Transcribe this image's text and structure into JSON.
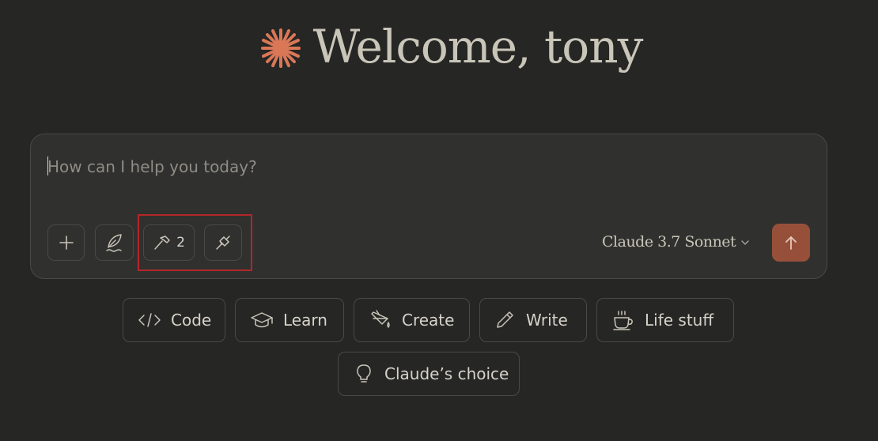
{
  "greeting": {
    "text": "Welcome, tony",
    "logo_icon": "claude-spark-icon",
    "logo_color": "#d97757"
  },
  "composer": {
    "placeholder": "How can I help you today?",
    "value": "",
    "buttons": {
      "add_icon": "plus-icon",
      "style_icon": "feather-icon",
      "tools_icon": "hammer-icon",
      "tools_count": "2",
      "integrations_icon": "plug-icon"
    },
    "model_label": "Claude 3.7 Sonnet",
    "send_icon": "arrow-up-icon",
    "send_color": "#96503a"
  },
  "suggestions": [
    {
      "label": "Code",
      "icon": "code-icon"
    },
    {
      "label": "Learn",
      "icon": "graduation-cap-icon"
    },
    {
      "label": "Create",
      "icon": "paint-bucket-icon"
    },
    {
      "label": "Write",
      "icon": "pencil-icon"
    },
    {
      "label": "Life stuff",
      "icon": "coffee-cup-icon"
    },
    {
      "label": "Claude’s choice",
      "icon": "lightbulb-icon"
    }
  ],
  "annotation_color": "#b3262a"
}
